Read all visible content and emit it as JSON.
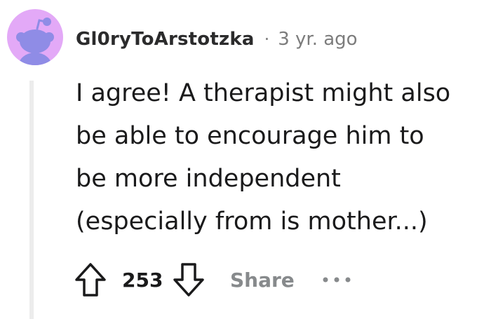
{
  "comment": {
    "username": "Gl0ryToArstotzka",
    "separator": "·",
    "timestamp": "3 yr. ago",
    "body_lines": [
      "I agree! A therapist might also",
      "be able to encourage him to",
      "be more independent",
      "(especially from is mother...)"
    ],
    "score": "253",
    "share_label": "Share"
  },
  "icons": {
    "avatar": "reddit-snoo-avatar-icon",
    "upvote": "upvote-arrow-icon",
    "downvote": "downvote-arrow-icon",
    "more": "more-options-icon"
  },
  "colors": {
    "avatar_bg": "#e3a9f7",
    "avatar_figure": "#8f8ce6",
    "muted_text": "#7c7c7c",
    "thread_line": "#ececec"
  }
}
